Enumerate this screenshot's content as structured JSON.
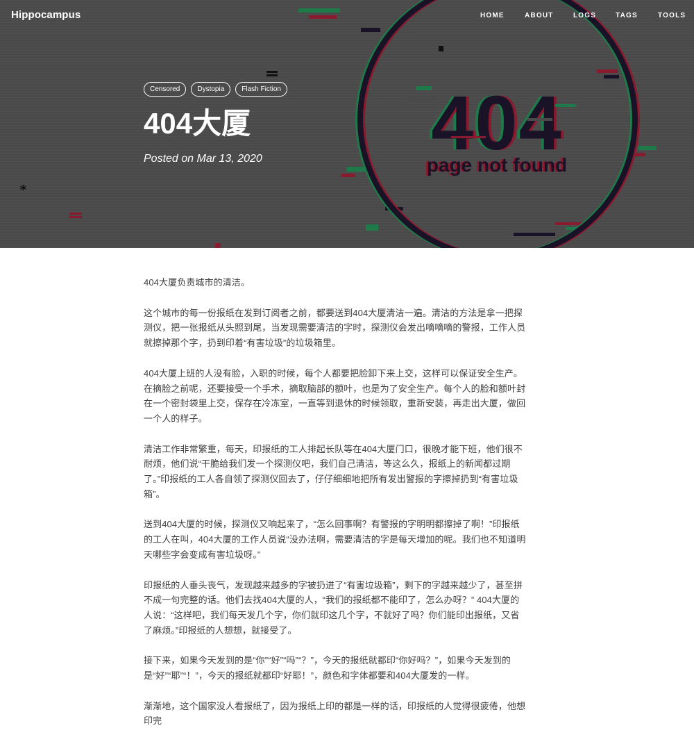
{
  "site": {
    "brand": "Hippocampus",
    "nav": [
      "HOME",
      "ABOUT",
      "LOGS",
      "TAGS",
      "TOOLS"
    ]
  },
  "hero": {
    "tags": [
      "Censored",
      "Dystopia",
      "Flash Fiction"
    ],
    "title": "404大厦",
    "meta": "Posted on Mar 13, 2020",
    "image_text": {
      "code": "404",
      "caption": "page not found"
    },
    "colors": {
      "background": "#4a4a4a",
      "glitch_red": "#8a1a2e",
      "glitch_green": "#1f7a4a",
      "glitch_dark": "#1a1226"
    }
  },
  "article": {
    "paragraphs": [
      "404大厦负责城市的清洁。",
      "这个城市的每一份报纸在发到订阅者之前，都要送到404大厦清洁一遍。清洁的方法是拿一把探测仪，把一张报纸从头照到尾，当发现需要清洁的字时，探测仪会发出嘀嘀嘀的警报，工作人员就擦掉那个字，扔到印着“有害垃圾”的垃圾箱里。",
      "404大厦上班的人没有脸，入职的时候，每个人都要把脸卸下来上交，这样可以保证安全生产。在摘脸之前呢，还要接受一个手术，摘取脑部的额叶，也是为了安全生产。每个人的脸和额叶封在一个密封袋里上交，保存在冷冻室，一直等到退休的时候领取，重新安装，再走出大厦，做回一个人的样子。",
      "清洁工作非常繁重，每天，印报纸的工人排起长队等在404大厦门口，很晚才能下班，他们很不耐烦，他们说“干脆给我们发一个探测仪吧，我们自己清洁，等这么久，报纸上的新闻都过期了。”印报纸的工人各自领了探测仪回去了，仔仔细细地把所有发出警报的字擦掉扔到“有害垃圾箱”。",
      "送到404大厦的时候，探测仪又响起来了，“怎么回事啊？有警报的字明明都擦掉了啊！”印报纸的工人在叫，404大厦的工作人员说“没办法啊，需要清洁的字是每天增加的呢。我们也不知道明天哪些字会变成有害垃圾呀。”",
      "印报纸的人垂头丧气，发现越来越多的字被扔进了“有害垃圾箱”，剩下的字越来越少了，甚至拼不成一句完整的话。他们去找404大厦的人，“我们的报纸都不能印了，怎么办呀？” 404大厦的人说：“这样吧，我们每天发几个字，你们就印这几个字，不就好了吗？你们能印出报纸，又省了麻烦。”印报纸的人想想，就接受了。",
      "接下来，如果今天发到的是“你”“好”“吗”“？”，今天的报纸就都印“你好吗？”，如果今天发到的是“好”“耶”“！”，今天的报纸就都印“好耶！”，颜色和字体都要和404大厦发的一样。",
      "渐渐地，这个国家没人看报纸了，因为报纸上印的都是一样的话，印报纸的人觉得很疲倦，他想印完"
    ]
  }
}
